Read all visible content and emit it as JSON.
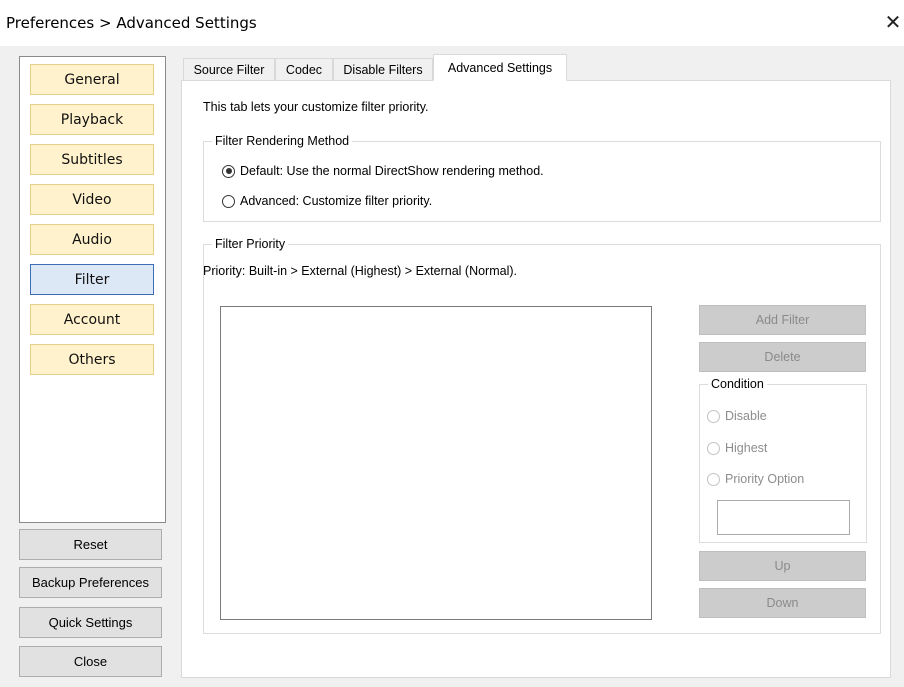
{
  "window": {
    "title": "Preferences > Advanced Settings",
    "close_glyph": "✕"
  },
  "nav": {
    "items": [
      "General",
      "Playback",
      "Subtitles",
      "Video",
      "Audio",
      "Filter",
      "Account",
      "Others"
    ],
    "active": "Filter"
  },
  "bottom_buttons": {
    "reset": "Reset",
    "backup": "Backup Preferences",
    "quick": "Quick Settings",
    "close": "Close"
  },
  "tabs": {
    "items": [
      "Source Filter",
      "Codec",
      "Disable Filters",
      "Advanced Settings"
    ],
    "active": "Advanced Settings"
  },
  "content": {
    "description": "This tab lets your customize filter priority.",
    "rendering_group": {
      "title": "Filter Rendering Method",
      "options": [
        {
          "label": "Default: Use the normal DirectShow rendering method.",
          "checked": true
        },
        {
          "label": "Advanced: Customize filter priority.",
          "checked": false
        }
      ]
    },
    "priority_group": {
      "title": "Filter Priority",
      "priority_text": "Priority: Built-in > External (Highest) > External (Normal).",
      "add_filter": "Add Filter",
      "delete": "Delete",
      "condition": {
        "title": "Condition",
        "options": [
          "Disable",
          "Highest",
          "Priority Option"
        ],
        "input_value": ""
      },
      "up": "Up",
      "down": "Down"
    }
  }
}
